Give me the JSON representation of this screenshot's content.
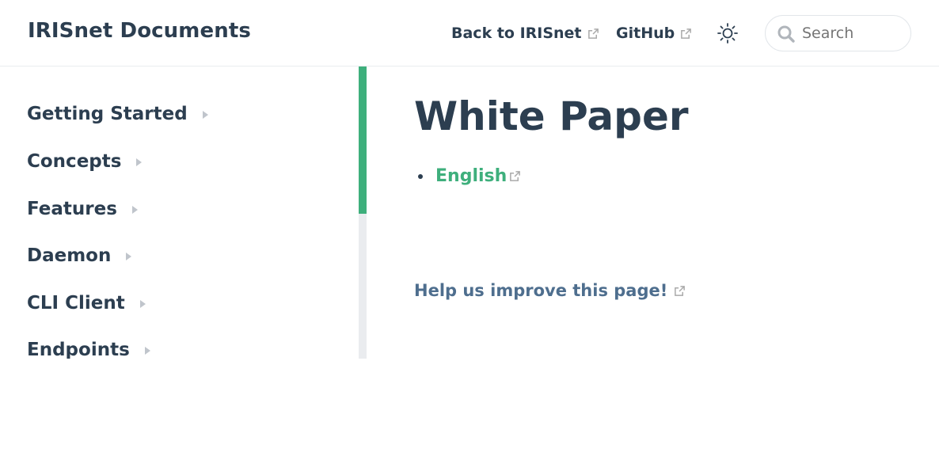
{
  "navbar": {
    "site_name": "IRISnet Documents",
    "links": [
      {
        "label": "Back to IRISnet",
        "icon": "external-link-icon"
      },
      {
        "label": "GitHub",
        "icon": "external-link-icon"
      }
    ],
    "theme_toggle_icon": "sun-icon",
    "search": {
      "placeholder": "Search",
      "value": "",
      "icon": "search-icon"
    }
  },
  "sidebar": {
    "items": [
      {
        "label": "Getting Started"
      },
      {
        "label": "Concepts"
      },
      {
        "label": "Features"
      },
      {
        "label": "Daemon"
      },
      {
        "label": "CLI Client"
      },
      {
        "label": "Endpoints"
      }
    ],
    "scrollbar_thumb_color": "#3eaf7c"
  },
  "main": {
    "title": "White Paper",
    "links": [
      {
        "label": "English",
        "icon": "external-link-icon"
      }
    ],
    "edit_link": "Help us improve this page!"
  },
  "colors": {
    "accent": "#3eaf7c",
    "text": "#2c3e50",
    "edit_link": "#4e6e8e"
  }
}
